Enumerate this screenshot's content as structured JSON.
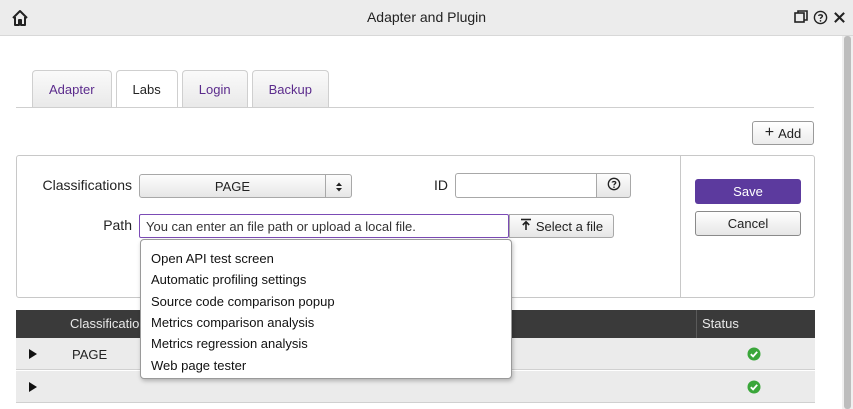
{
  "window": {
    "title": "Adapter and Plugin",
    "icons": [
      "home-icon",
      "restore-icon",
      "help-icon",
      "close-icon"
    ]
  },
  "tabs": [
    {
      "label": "Adapter",
      "active": false
    },
    {
      "label": "Labs",
      "active": true
    },
    {
      "label": "Login",
      "active": false
    },
    {
      "label": "Backup",
      "active": false
    }
  ],
  "toolbar": {
    "add_label": "Add",
    "add_icon": "plus-icon"
  },
  "form": {
    "classifications_label": "Classifications",
    "classifications_value": "PAGE",
    "id_label": "ID",
    "id_value": "",
    "path_label": "Path",
    "path_placeholder": "You can enter an file path or upload a local file.",
    "select_file_label": "Select a file",
    "save_label": "Save",
    "cancel_label": "Cancel"
  },
  "dropdown": {
    "items": [
      "Open API test screen",
      "Automatic profiling settings",
      "Source code comparison popup",
      "Metrics comparison analysis",
      "Metrics regression analysis",
      "Web page tester"
    ]
  },
  "grid": {
    "columns": [
      "Classificatio",
      "Status"
    ],
    "rows": [
      {
        "name": "PAGE",
        "status": "ok"
      },
      {
        "name": "",
        "status": "ok"
      }
    ]
  },
  "colors": {
    "accent": "#5c3a9e",
    "tab_text": "#5b2b8c",
    "status_ok": "#3aa63a",
    "grid_header": "#3a3a3a"
  }
}
